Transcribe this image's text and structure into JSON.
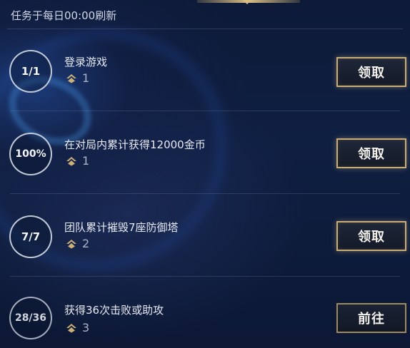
{
  "header": {
    "refresh_text": "任务于每日00:00刷新"
  },
  "tasks": [
    {
      "progress": "1/1",
      "title": "登录游戏",
      "reward": "1",
      "button": "领取"
    },
    {
      "progress": "100%",
      "title": "在对局内累计获得12000金币",
      "reward": "1",
      "button": "领取"
    },
    {
      "progress": "7/7",
      "title": "团队累计摧毁7座防御塔",
      "reward": "2",
      "button": "领取"
    },
    {
      "progress": "28/36",
      "title": "获得36次击败或助攻",
      "reward": "3",
      "button": "前往"
    }
  ],
  "icons": {
    "reward": "reward-chevron-icon"
  },
  "colors": {
    "accent_gold": "#c9ad74",
    "background": "#0f1f42"
  }
}
